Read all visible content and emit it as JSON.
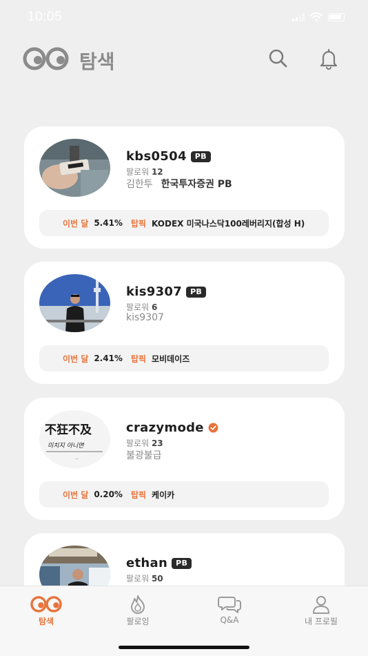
{
  "status_bar": {
    "time": "10:05"
  },
  "header": {
    "title": "탐색",
    "search_icon": "search-icon",
    "bell_icon": "bell-icon"
  },
  "colors": {
    "accent": "#e8743b",
    "badge": "#2a2a2a",
    "background": "#efefef"
  },
  "stats_labels": {
    "month": "이번 달",
    "pick": "탑픽"
  },
  "profiles": [
    {
      "username": "kbs0504",
      "badge": "PB",
      "followers_label": "팔로워",
      "followers": "12",
      "name": "김한투",
      "firm": "한국투자증권 PB",
      "month_return": "5.41%",
      "top_pick": "KODEX 미국나스닥100레버리지(합성 H)"
    },
    {
      "username": "kis9307",
      "badge": "PB",
      "followers_label": "팔로워",
      "followers": "6",
      "name": "kis9307",
      "firm": "",
      "month_return": "2.41%",
      "top_pick": "모비데이즈"
    },
    {
      "username": "crazymode",
      "badge": "",
      "verified": true,
      "followers_label": "팔로워",
      "followers": "23",
      "name": "불광불급",
      "firm": "",
      "month_return": "0.20%",
      "top_pick": "케이카"
    },
    {
      "username": "ethan",
      "badge": "PB",
      "followers_label": "팔로워",
      "followers": "50",
      "name": "",
      "firm": "",
      "month_return": "",
      "top_pick": ""
    }
  ],
  "tabs": [
    {
      "label": "탐색",
      "icon": "eyes-icon",
      "active": true
    },
    {
      "label": "팔로잉",
      "icon": "flame-icon",
      "active": false
    },
    {
      "label": "Q&A",
      "icon": "chat-bubbles-icon",
      "active": false
    },
    {
      "label": "내 프로필",
      "icon": "person-icon",
      "active": false
    }
  ]
}
